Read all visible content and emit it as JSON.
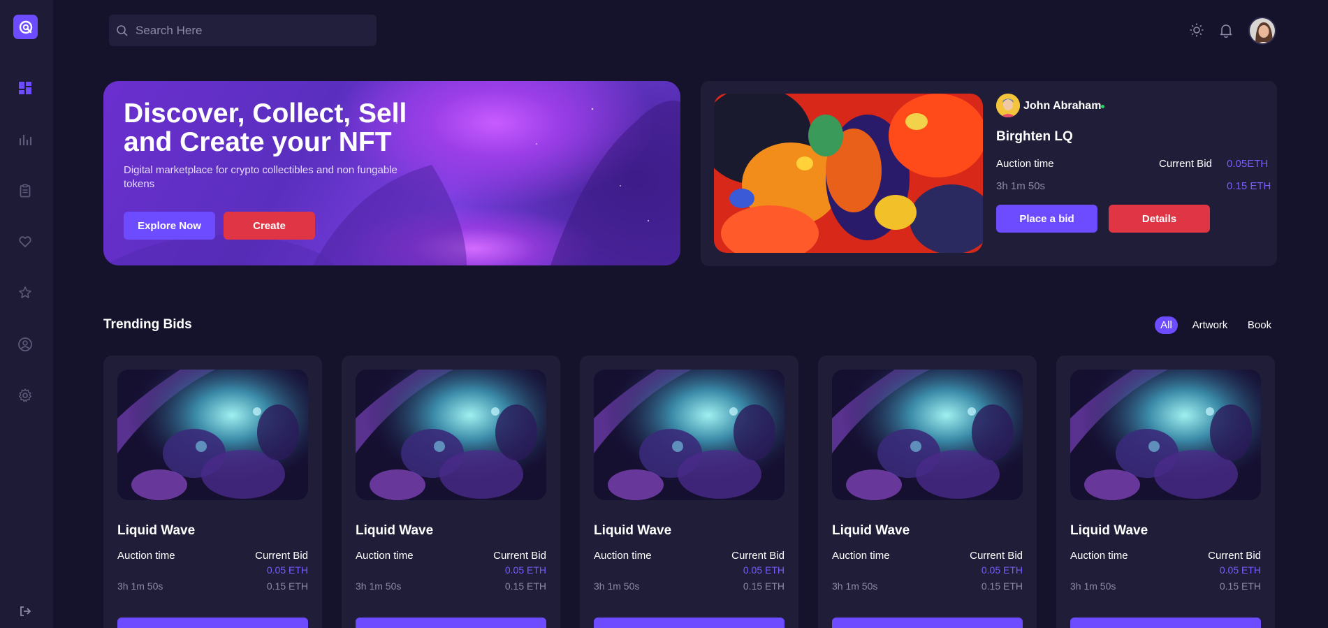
{
  "search": {
    "placeholder": "Search Here"
  },
  "hero": {
    "title_line1": "Discover, Collect, Sell",
    "title_line2": "and Create your NFT",
    "subtitle": "Digital marketplace for crypto collectibles and non fungable tokens",
    "explore_label": "Explore Now",
    "create_label": "Create"
  },
  "featured": {
    "owner": "John Abraham",
    "title": "Birghten LQ",
    "auction_label": "Auction time",
    "bid_label": "Current Bid",
    "bid_value": "0.05ETH",
    "time_value": "3h 1m 50s",
    "bid_value2": "0.15 ETH",
    "place_bid_label": "Place a bid",
    "details_label": "Details"
  },
  "trending": {
    "title": "Trending Bids",
    "filters": [
      "All",
      "Artwork",
      "Book"
    ],
    "cards": [
      {
        "title": "Liquid Wave",
        "auction_label": "Auction time",
        "bid_label": "Current Bid",
        "bid": "0.05 ETH",
        "time": "3h 1m 50s",
        "bid2": "0.15 ETH"
      },
      {
        "title": "Liquid Wave",
        "auction_label": "Auction time",
        "bid_label": "Current Bid",
        "bid": "0.05 ETH",
        "time": "3h 1m 50s",
        "bid2": "0.15 ETH"
      },
      {
        "title": "Liquid Wave",
        "auction_label": "Auction time",
        "bid_label": "Current Bid",
        "bid": "0.05 ETH",
        "time": "3h 1m 50s",
        "bid2": "0.15 ETH"
      },
      {
        "title": "Liquid Wave",
        "auction_label": "Auction time",
        "bid_label": "Current Bid",
        "bid": "0.05 ETH",
        "time": "3h 1m 50s",
        "bid2": "0.15 ETH"
      },
      {
        "title": "Liquid Wave",
        "auction_label": "Auction time",
        "bid_label": "Current Bid",
        "bid": "0.05 ETH",
        "time": "3h 1m 50s",
        "bid2": "0.15 ETH"
      }
    ]
  },
  "sidebar": {
    "icons": [
      "dashboard-icon",
      "chart-icon",
      "clipboard-icon",
      "heart-icon",
      "star-icon",
      "user-icon",
      "settings-icon",
      "logout-icon"
    ]
  },
  "colors": {
    "background": "#15132b",
    "panel": "#1f1d38",
    "accent": "#6d4cff",
    "danger": "#e03545",
    "muted": "#8c8aa6",
    "online": "#2bd46a"
  }
}
